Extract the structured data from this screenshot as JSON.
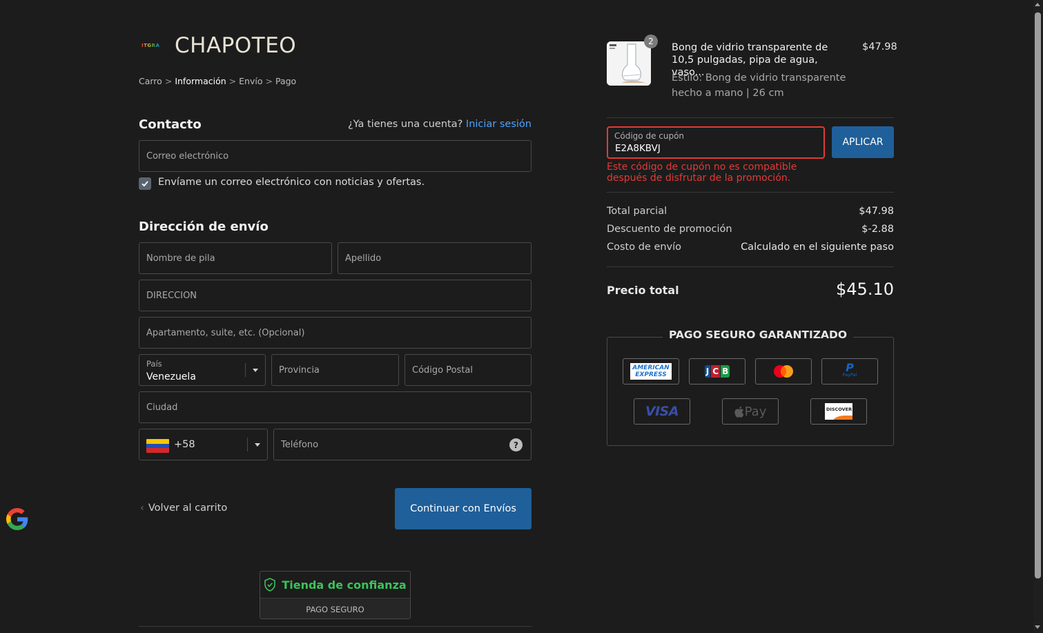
{
  "brand": {
    "logo_text": "ITGRA",
    "name": "CHAPOTEO"
  },
  "breadcrumb": {
    "cart": "Carro",
    "info": "Información",
    "shipping": "Envío",
    "payment": "Pago",
    "separator": ">"
  },
  "contact": {
    "title": "Contacto",
    "account_question": "¿Ya tienes una cuenta?",
    "login_link": "Iniciar sesión",
    "email_placeholder": "Correo electrónico",
    "newsletter_label": "Envíame un correo electrónico con noticias y ofertas.",
    "newsletter_checked": true
  },
  "shipping": {
    "title": "Dirección de envío",
    "first_name_placeholder": "Nombre de pila",
    "last_name_placeholder": "Apellido",
    "address_placeholder": "DIRECCIÓN",
    "apartment_placeholder": "Apartamento, suite, etc. (Opcional)",
    "country_label": "País",
    "country_value": "Venezuela",
    "province_placeholder": "Provincia",
    "postal_placeholder": "Código Postal",
    "city_placeholder": "Ciudad",
    "phone_code": "+58",
    "phone_placeholder": "Teléfono",
    "help_icon": "?"
  },
  "actions": {
    "back_label": "Volver al carrito",
    "back_chevron": "‹",
    "continue_label": "Continuar con Envíos"
  },
  "trust": {
    "title": "Tienda de confianza",
    "subtitle": "PAGO SEGURO"
  },
  "order": {
    "quantity": "2",
    "product_name": "Bong de vidrio transparente de 10,5 pulgadas, pipa de agua, vaso...",
    "product_style": "Estilo: Bong de vidrio transparente hecho a mano | 26 cm",
    "product_price": "$47.98"
  },
  "coupon": {
    "label": "Código de cupón",
    "value": "E2A8KBVJ",
    "apply_label": "APLICAR",
    "error": "Este código de cupón no es compatible después de disfrutar de la promoción."
  },
  "summary": {
    "subtotal_label": "Total parcial",
    "subtotal_value": "$47.98",
    "discount_label": "Descuento de promoción",
    "discount_value": "$-2.88",
    "shipping_label": "Costo de envío",
    "shipping_value": "Calculado en el siguiente paso",
    "total_label": "Precio total",
    "total_value": "$45.10"
  },
  "secure": {
    "title": "PAGO SEGURO GARANTIZADO",
    "amex_line1": "AMERICAN",
    "amex_line2": "EXPRESS",
    "jcb": "JCB",
    "paypal": "PayPal",
    "visa": "VISA",
    "applepay": "Pay",
    "discover": "DISCOVER"
  },
  "colors": {
    "accent": "#1f5f9a",
    "error": "#e53935",
    "trust": "#3bc35a",
    "link": "#4ea3ff",
    "background": "#1c1c1c"
  }
}
